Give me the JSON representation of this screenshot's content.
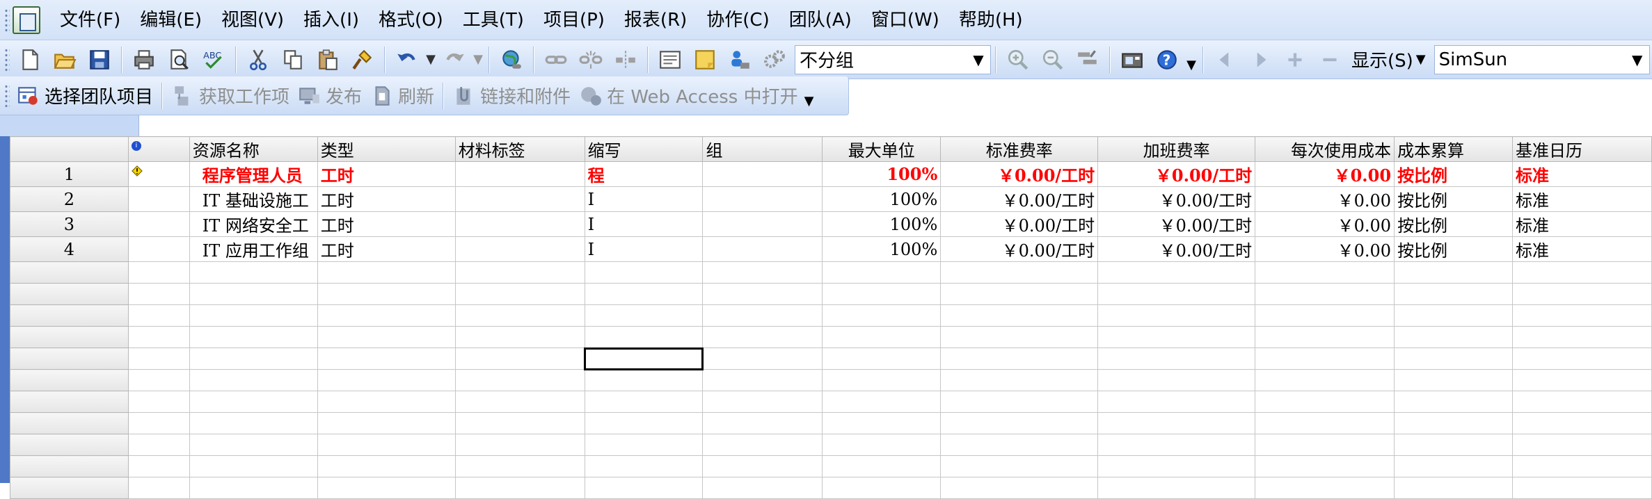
{
  "menu": {
    "items": [
      "文件(F)",
      "编辑(E)",
      "视图(V)",
      "插入(I)",
      "格式(O)",
      "工具(T)",
      "项目(P)",
      "报表(R)",
      "协作(C)",
      "团队(A)",
      "窗口(W)",
      "帮助(H)"
    ]
  },
  "toolbar": {
    "group_combo": "不分组",
    "show_label": "显示(S)",
    "font_combo": "SimSun"
  },
  "team_toolbar": {
    "select_project": "选择团队项目",
    "get_work_items": "获取工作项",
    "publish": "发布",
    "refresh": "刷新",
    "links_attachments": "链接和附件",
    "open_web_access": "在 Web Access 中打开"
  },
  "grid": {
    "columns": [
      "资源名称",
      "类型",
      "材料标签",
      "缩写",
      "组",
      "最大单位",
      "标准费率",
      "加班费率",
      "每次使用成本",
      "成本累算",
      "基准日历"
    ],
    "rows": [
      {
        "num": "1",
        "name": "程序管理人员",
        "type": "工时",
        "material": "",
        "initials": "程",
        "group": "",
        "max_units": "100%",
        "std_rate": "￥0.00/工时",
        "ovt_rate": "￥0.00/工时",
        "cost_use": "￥0.00",
        "accrue": "按比例",
        "calendar": "标准"
      },
      {
        "num": "2",
        "name": "IT 基础设施工",
        "type": "工时",
        "material": "",
        "initials": "I",
        "group": "",
        "max_units": "100%",
        "std_rate": "￥0.00/工时",
        "ovt_rate": "￥0.00/工时",
        "cost_use": "￥0.00",
        "accrue": "按比例",
        "calendar": "标准"
      },
      {
        "num": "3",
        "name": "IT 网络安全工",
        "type": "工时",
        "material": "",
        "initials": "I",
        "group": "",
        "max_units": "100%",
        "std_rate": "￥0.00/工时",
        "ovt_rate": "￥0.00/工时",
        "cost_use": "￥0.00",
        "accrue": "按比例",
        "calendar": "标准"
      },
      {
        "num": "4",
        "name": "IT 应用工作组",
        "type": "工时",
        "material": "",
        "initials": "I",
        "group": "",
        "max_units": "100%",
        "std_rate": "￥0.00/工时",
        "ovt_rate": "￥0.00/工时",
        "cost_use": "￥0.00",
        "accrue": "按比例",
        "calendar": "标准"
      }
    ]
  },
  "colors": {
    "highlight_text": "#ff0000",
    "left_strip": "#4f79c6",
    "toolbar_top": "#eaf2fd",
    "toolbar_bottom": "#cbdcf5"
  }
}
